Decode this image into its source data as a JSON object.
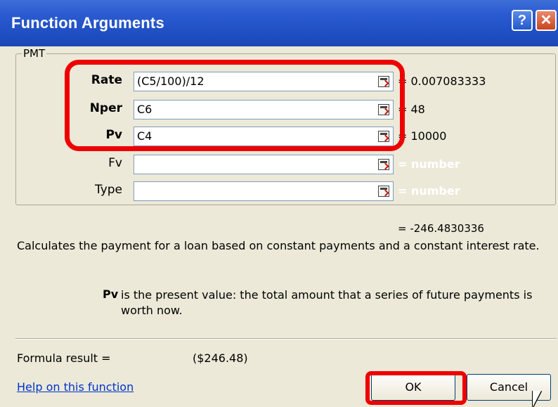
{
  "window": {
    "title": "Function Arguments",
    "help_glyph": "?",
    "close_glyph": "✕"
  },
  "function": {
    "name": "PMT",
    "arguments": [
      {
        "name": "Rate",
        "required": true,
        "value": "(C5/100)/12",
        "evaluated": "= 0.007083333"
      },
      {
        "name": "Nper",
        "required": true,
        "value": "C6",
        "evaluated": "= 48"
      },
      {
        "name": "Pv",
        "required": true,
        "value": "C4",
        "evaluated": "= 10000"
      },
      {
        "name": "Fv",
        "required": false,
        "value": "",
        "evaluated": "= number"
      },
      {
        "name": "Type",
        "required": false,
        "value": "",
        "evaluated": "= number"
      }
    ],
    "result": "= -246.4830336",
    "description": "Calculates the payment for a loan based on constant payments and a constant interest rate.",
    "arg_help": {
      "name": "Pv",
      "text_line1": "is the present value: the total amount that a series of future payments is",
      "text_line2": "worth now."
    }
  },
  "footer": {
    "formula_result_label": "Formula result =",
    "formula_result_value": "($246.48)",
    "help_link": "Help on this function",
    "ok_label": "OK",
    "cancel_label": "Cancel"
  },
  "icons": {
    "ref_button": "collapse-dialog-icon"
  },
  "colors": {
    "titlebar": "#245ad0",
    "dialog_bg": "#ece9d8",
    "highlight": "#ee0000",
    "link": "#0033cc"
  }
}
